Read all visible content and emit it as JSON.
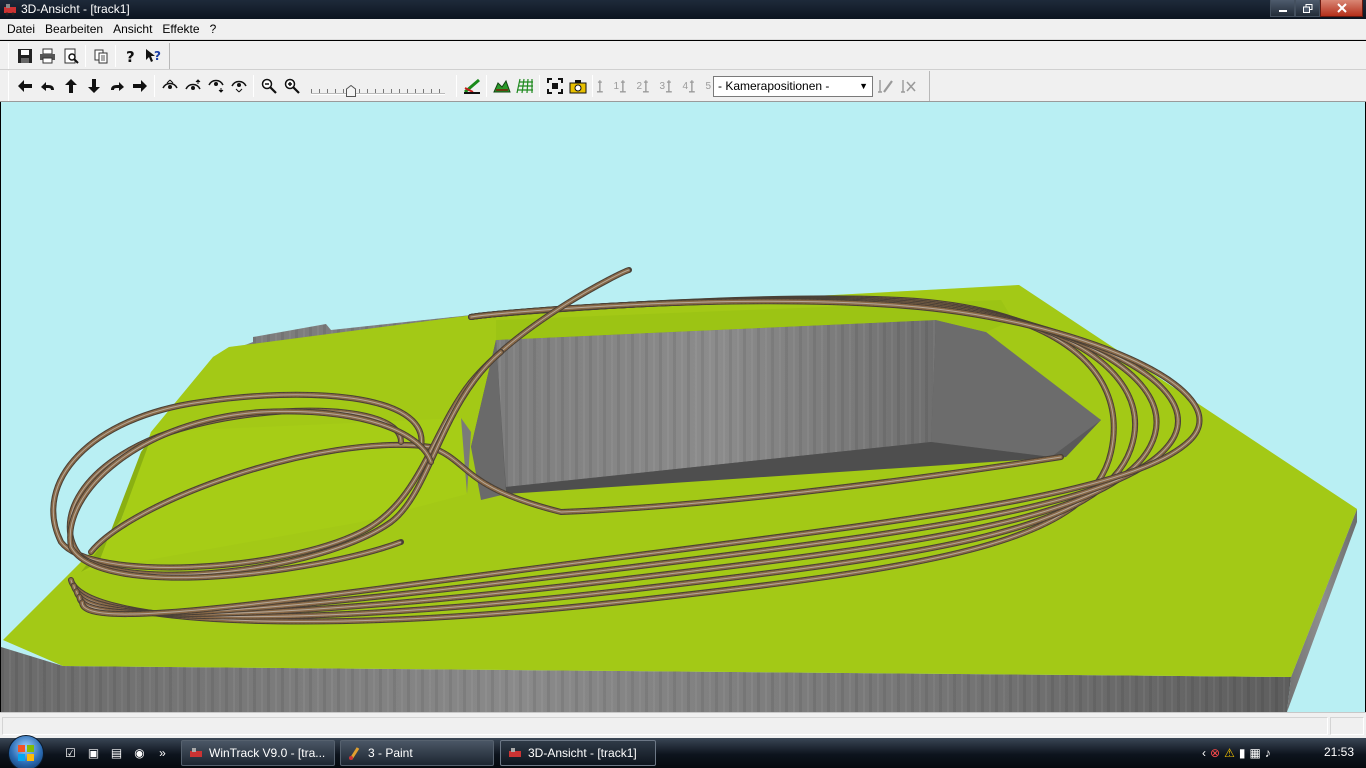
{
  "window": {
    "title": "3D-Ansicht - [track1]"
  },
  "menu": [
    "Datei",
    "Bearbeiten",
    "Ansicht",
    "Effekte",
    "?"
  ],
  "toolbar": {
    "camera_select": "- Kamerapositionen -",
    "camera_positions": [
      "1",
      "2",
      "3",
      "4",
      "5"
    ],
    "zoom_level": 0.28
  },
  "viewport": {
    "sky_color": "#b9eff3",
    "grass_color": "#9cc414",
    "wall_color": "#7a7a7a"
  },
  "taskbar": {
    "tasks": [
      {
        "label": "WinTrack  V9.0 - [tra...",
        "icon": "wintrack-icon"
      },
      {
        "label": "3 - Paint",
        "icon": "paint-icon"
      },
      {
        "label": "3D-Ansicht - [track1]",
        "icon": "wintrack-icon"
      }
    ],
    "overflow": "»",
    "clock": "21:53"
  }
}
